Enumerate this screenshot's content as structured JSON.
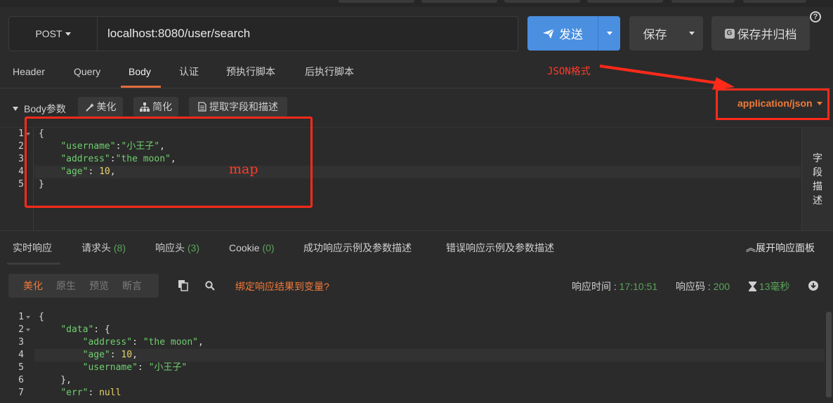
{
  "request": {
    "method": "POST",
    "url": "localhost:8080/user/search",
    "send_label": "发送",
    "save_label": "保存",
    "archive_label": "保存并归档",
    "tabs": [
      {
        "label": "Header"
      },
      {
        "label": "Query"
      },
      {
        "label": "Body"
      },
      {
        "label": "认证"
      },
      {
        "label": "预执行脚本"
      },
      {
        "label": "后执行脚本"
      }
    ],
    "active_tab": "Body"
  },
  "body": {
    "section_label": "Body参数",
    "beautify_label": "美化",
    "simplify_label": "简化",
    "extract_label": "提取字段和描述",
    "content_type": "application/json",
    "side_label": [
      "字",
      "段",
      "描",
      "述"
    ],
    "lines": [
      "1",
      "2",
      "3",
      "4",
      "5"
    ]
  },
  "annotations": {
    "json_format": "JSON格式",
    "map": "map"
  },
  "response": {
    "tabs": [
      {
        "label": "实时响应",
        "count": ""
      },
      {
        "label": "请求头",
        "count": "(8)"
      },
      {
        "label": "响应头",
        "count": "(3)"
      },
      {
        "label": "Cookie",
        "count": "(0)"
      },
      {
        "label": "成功响应示例及参数描述",
        "count": ""
      },
      {
        "label": "错误响应示例及参数描述",
        "count": ""
      }
    ],
    "expand_label": "展开响应面板",
    "view_modes": [
      "美化",
      "原生",
      "预览",
      "断言"
    ],
    "active_view": "美化",
    "bind_link": "绑定响应结果到变量?",
    "time_label": "响应时间 : ",
    "time_value": "17:10:51",
    "code_label": "响应码 : ",
    "code_value": "200",
    "duration_value": "13毫秒",
    "lines": [
      "1",
      "2",
      "3",
      "4",
      "5",
      "6",
      "7"
    ]
  },
  "colors": {
    "accent_orange": "#f07a3a",
    "primary_blue": "#4a8fe0",
    "annotation_red": "#ff2a1a",
    "json_green": "#6fcf6f",
    "number_yellow": "#e8d36a"
  }
}
